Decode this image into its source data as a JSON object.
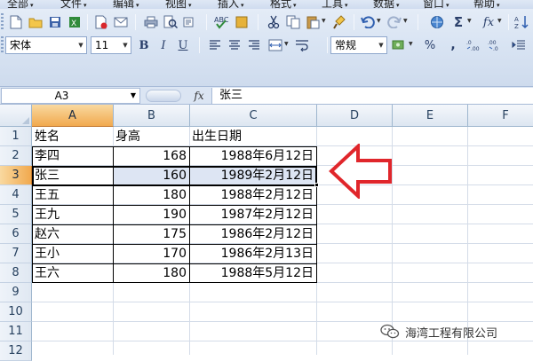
{
  "menubar": {
    "items": [
      {
        "label": "全部",
        "has_arrow": true
      },
      {
        "label": "文件",
        "has_arrow": true
      },
      {
        "label": "编辑",
        "has_arrow": true
      },
      {
        "label": "视图",
        "has_arrow": true
      },
      {
        "label": "插入",
        "has_arrow": true
      },
      {
        "label": "格式",
        "has_arrow": true
      },
      {
        "label": "工具",
        "has_arrow": true
      },
      {
        "label": "数据",
        "has_arrow": true
      },
      {
        "label": "窗口",
        "has_arrow": true
      },
      {
        "label": "帮助",
        "has_arrow": true
      }
    ]
  },
  "toolbar": {
    "font_name": "宋体",
    "font_size": "11",
    "bold": "B",
    "italic": "I",
    "underline": "U",
    "number_format": "常规",
    "percent": "%",
    "comma": ",",
    "sigma": "Σ",
    "fx": "fx"
  },
  "formula_bar": {
    "name_box": "A3",
    "fx_label": "fx",
    "content": "张三"
  },
  "sheet": {
    "columns": [
      "A",
      "B",
      "C",
      "D",
      "E",
      "F"
    ],
    "active_column": "A",
    "rows": [
      "1",
      "2",
      "3",
      "4",
      "5",
      "6",
      "7",
      "8",
      "9",
      "10",
      "11",
      "12"
    ],
    "active_row": "3",
    "header": {
      "name": "姓名",
      "height": "身高",
      "birth": "出生日期"
    },
    "records": [
      {
        "name": "李四",
        "height": "168",
        "birth": "1988年6月12日"
      },
      {
        "name": "张三",
        "height": "160",
        "birth": "1989年2月12日"
      },
      {
        "name": "王五",
        "height": "180",
        "birth": "1988年2月12日"
      },
      {
        "name": "王九",
        "height": "190",
        "birth": "1987年2月12日"
      },
      {
        "name": "赵六",
        "height": "175",
        "birth": "1986年2月12日"
      },
      {
        "name": "王小",
        "height": "170",
        "birth": "1986年2月13日"
      },
      {
        "name": "王六",
        "height": "180",
        "birth": "1988年5月12日"
      }
    ]
  },
  "annotation": {
    "arrow_color": "#e0262b"
  },
  "watermark": {
    "text": "海湾工程有限公司",
    "icon": "wechat-icon"
  },
  "colors": {
    "selected_header": "#f1a94e",
    "row_highlight": "#dde5f3",
    "toolbar_bg": "#d9e4f3"
  }
}
